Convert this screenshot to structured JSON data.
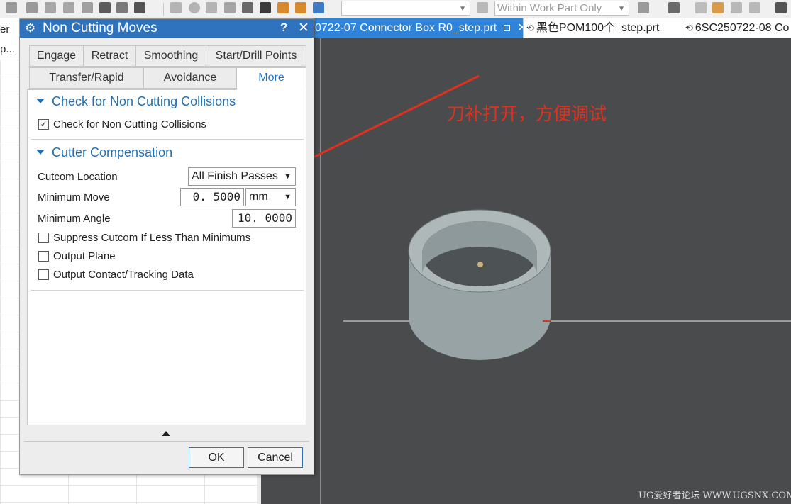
{
  "toolbar": {
    "filter_placeholder": "",
    "scope_combo": "Within Work Part Only",
    "colors": {
      "icon_gray": "#8a8a8a",
      "icon_orange": "#d98a2b",
      "icon_blue": "#3d7bc4"
    }
  },
  "navigator": {
    "header_fragment": "er",
    "row_fragment": "p..."
  },
  "doc_tabs": [
    {
      "label": "0722-07 Connector Box R0_step.prt",
      "close": "✕"
    },
    {
      "label": "黑色POM100个_step.prt"
    },
    {
      "label": "6SC250722-08 Co"
    }
  ],
  "dialog": {
    "title": "Non Cutting Moves",
    "help": "?",
    "close": "✕",
    "tabs_row1": [
      {
        "label": "Engage"
      },
      {
        "label": "Retract"
      },
      {
        "label": "Smoothing"
      },
      {
        "label": "Start/Drill Points"
      }
    ],
    "tabs_row2": [
      {
        "label": "Transfer/Rapid"
      },
      {
        "label": "Avoidance"
      },
      {
        "label": "More",
        "active": true
      }
    ],
    "groups": {
      "collisions": {
        "title": "Check for Non Cutting Collisions",
        "check_label": "Check for Non Cutting Collisions",
        "checked": true
      },
      "cutcom": {
        "title": "Cutter Compensation",
        "location_label": "Cutcom Location",
        "location_value": "All Finish Passes",
        "min_move_label": "Minimum Move",
        "min_move_value": "0. 5000",
        "min_move_unit": "mm",
        "min_angle_label": "Minimum Angle",
        "min_angle_value": "10. 0000",
        "options": [
          {
            "label": "Suppress Cutcom If Less Than Minimums",
            "checked": false
          },
          {
            "label": "Output Plane",
            "checked": false
          },
          {
            "label": "Output Contact/Tracking Data",
            "checked": false
          }
        ]
      }
    },
    "buttons": {
      "ok": "OK",
      "cancel": "Cancel"
    }
  },
  "annotation": {
    "text": "刀补打开，方便调试",
    "color": "#e0311f"
  },
  "watermark": "UG爱好者论坛 WWW.UGSNX.COM",
  "colors": {
    "title_bar": "#2f72bd",
    "accent_text": "#1f70b8",
    "viewport_bg": "#4a4b4c",
    "model_face": "#a9b3b4"
  }
}
